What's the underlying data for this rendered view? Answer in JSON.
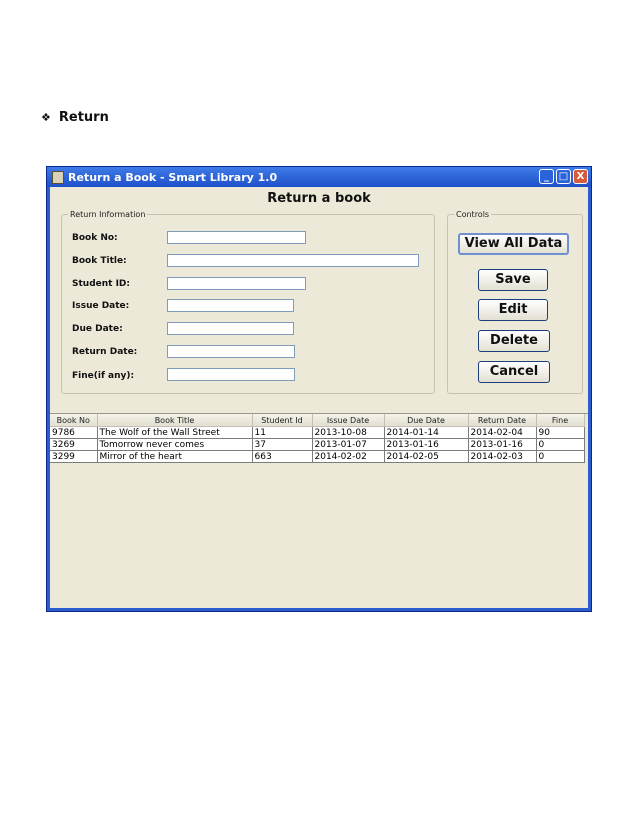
{
  "doc": {
    "bullet_symbol": "❖",
    "heading": "Return"
  },
  "window": {
    "title": "Return a Book - Smart Library 1.0",
    "controls": [
      "_",
      "□",
      "X"
    ]
  },
  "form": {
    "title": "Return a book",
    "info_legend": "Return Information",
    "controls_legend": "Controls",
    "labels": {
      "book_no": "Book No:",
      "book_title": "Book Title:",
      "student_id": "Student ID:",
      "issue_date": "Issue Date:",
      "due_date": "Due Date:",
      "return_date": "Return Date:",
      "fine": "Fine(if any):"
    },
    "values": {
      "book_no": "",
      "book_title": "",
      "student_id": "",
      "issue_date": "",
      "due_date": "",
      "return_date": "",
      "fine": ""
    },
    "buttons": {
      "view_all": "View All Data",
      "save": "Save",
      "edit": "Edit",
      "delete": "Delete",
      "cancel": "Cancel"
    }
  },
  "table": {
    "columns": [
      "Book No",
      "Book Title",
      "Student Id",
      "Issue Date",
      "Due Date",
      "Return Date",
      "Fine"
    ],
    "rows": [
      [
        "9786",
        "The Wolf of the Wall Street",
        "11",
        "2013-10-08",
        "2014-01-14",
        "2014-02-04",
        "90"
      ],
      [
        "3269",
        "Tomorrow never comes",
        "37",
        "2013-01-07",
        "2013-01-16",
        "2013-01-16",
        "0"
      ],
      [
        "3299",
        "Mirror of the heart",
        "663",
        "2014-02-02",
        "2014-02-05",
        "2014-02-03",
        "0"
      ]
    ]
  },
  "colors": {
    "titlebar": "#245edb",
    "client": "#ece9d8",
    "close_button": "#d85b3b"
  }
}
